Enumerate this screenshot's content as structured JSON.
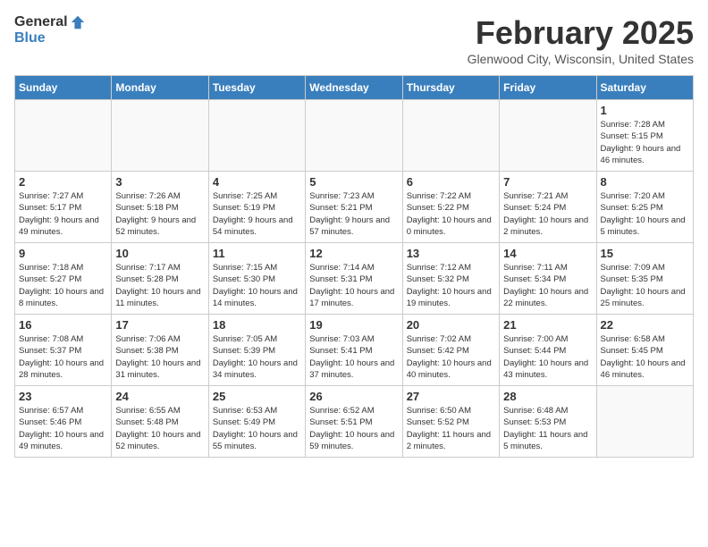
{
  "header": {
    "logo_general": "General",
    "logo_blue": "Blue",
    "month": "February 2025",
    "location": "Glenwood City, Wisconsin, United States"
  },
  "days_of_week": [
    "Sunday",
    "Monday",
    "Tuesday",
    "Wednesday",
    "Thursday",
    "Friday",
    "Saturday"
  ],
  "weeks": [
    [
      {
        "day": "",
        "info": ""
      },
      {
        "day": "",
        "info": ""
      },
      {
        "day": "",
        "info": ""
      },
      {
        "day": "",
        "info": ""
      },
      {
        "day": "",
        "info": ""
      },
      {
        "day": "",
        "info": ""
      },
      {
        "day": "1",
        "info": "Sunrise: 7:28 AM\nSunset: 5:15 PM\nDaylight: 9 hours and 46 minutes."
      }
    ],
    [
      {
        "day": "2",
        "info": "Sunrise: 7:27 AM\nSunset: 5:17 PM\nDaylight: 9 hours and 49 minutes."
      },
      {
        "day": "3",
        "info": "Sunrise: 7:26 AM\nSunset: 5:18 PM\nDaylight: 9 hours and 52 minutes."
      },
      {
        "day": "4",
        "info": "Sunrise: 7:25 AM\nSunset: 5:19 PM\nDaylight: 9 hours and 54 minutes."
      },
      {
        "day": "5",
        "info": "Sunrise: 7:23 AM\nSunset: 5:21 PM\nDaylight: 9 hours and 57 minutes."
      },
      {
        "day": "6",
        "info": "Sunrise: 7:22 AM\nSunset: 5:22 PM\nDaylight: 10 hours and 0 minutes."
      },
      {
        "day": "7",
        "info": "Sunrise: 7:21 AM\nSunset: 5:24 PM\nDaylight: 10 hours and 2 minutes."
      },
      {
        "day": "8",
        "info": "Sunrise: 7:20 AM\nSunset: 5:25 PM\nDaylight: 10 hours and 5 minutes."
      }
    ],
    [
      {
        "day": "9",
        "info": "Sunrise: 7:18 AM\nSunset: 5:27 PM\nDaylight: 10 hours and 8 minutes."
      },
      {
        "day": "10",
        "info": "Sunrise: 7:17 AM\nSunset: 5:28 PM\nDaylight: 10 hours and 11 minutes."
      },
      {
        "day": "11",
        "info": "Sunrise: 7:15 AM\nSunset: 5:30 PM\nDaylight: 10 hours and 14 minutes."
      },
      {
        "day": "12",
        "info": "Sunrise: 7:14 AM\nSunset: 5:31 PM\nDaylight: 10 hours and 17 minutes."
      },
      {
        "day": "13",
        "info": "Sunrise: 7:12 AM\nSunset: 5:32 PM\nDaylight: 10 hours and 19 minutes."
      },
      {
        "day": "14",
        "info": "Sunrise: 7:11 AM\nSunset: 5:34 PM\nDaylight: 10 hours and 22 minutes."
      },
      {
        "day": "15",
        "info": "Sunrise: 7:09 AM\nSunset: 5:35 PM\nDaylight: 10 hours and 25 minutes."
      }
    ],
    [
      {
        "day": "16",
        "info": "Sunrise: 7:08 AM\nSunset: 5:37 PM\nDaylight: 10 hours and 28 minutes."
      },
      {
        "day": "17",
        "info": "Sunrise: 7:06 AM\nSunset: 5:38 PM\nDaylight: 10 hours and 31 minutes."
      },
      {
        "day": "18",
        "info": "Sunrise: 7:05 AM\nSunset: 5:39 PM\nDaylight: 10 hours and 34 minutes."
      },
      {
        "day": "19",
        "info": "Sunrise: 7:03 AM\nSunset: 5:41 PM\nDaylight: 10 hours and 37 minutes."
      },
      {
        "day": "20",
        "info": "Sunrise: 7:02 AM\nSunset: 5:42 PM\nDaylight: 10 hours and 40 minutes."
      },
      {
        "day": "21",
        "info": "Sunrise: 7:00 AM\nSunset: 5:44 PM\nDaylight: 10 hours and 43 minutes."
      },
      {
        "day": "22",
        "info": "Sunrise: 6:58 AM\nSunset: 5:45 PM\nDaylight: 10 hours and 46 minutes."
      }
    ],
    [
      {
        "day": "23",
        "info": "Sunrise: 6:57 AM\nSunset: 5:46 PM\nDaylight: 10 hours and 49 minutes."
      },
      {
        "day": "24",
        "info": "Sunrise: 6:55 AM\nSunset: 5:48 PM\nDaylight: 10 hours and 52 minutes."
      },
      {
        "day": "25",
        "info": "Sunrise: 6:53 AM\nSunset: 5:49 PM\nDaylight: 10 hours and 55 minutes."
      },
      {
        "day": "26",
        "info": "Sunrise: 6:52 AM\nSunset: 5:51 PM\nDaylight: 10 hours and 59 minutes."
      },
      {
        "day": "27",
        "info": "Sunrise: 6:50 AM\nSunset: 5:52 PM\nDaylight: 11 hours and 2 minutes."
      },
      {
        "day": "28",
        "info": "Sunrise: 6:48 AM\nSunset: 5:53 PM\nDaylight: 11 hours and 5 minutes."
      },
      {
        "day": "",
        "info": ""
      }
    ]
  ]
}
